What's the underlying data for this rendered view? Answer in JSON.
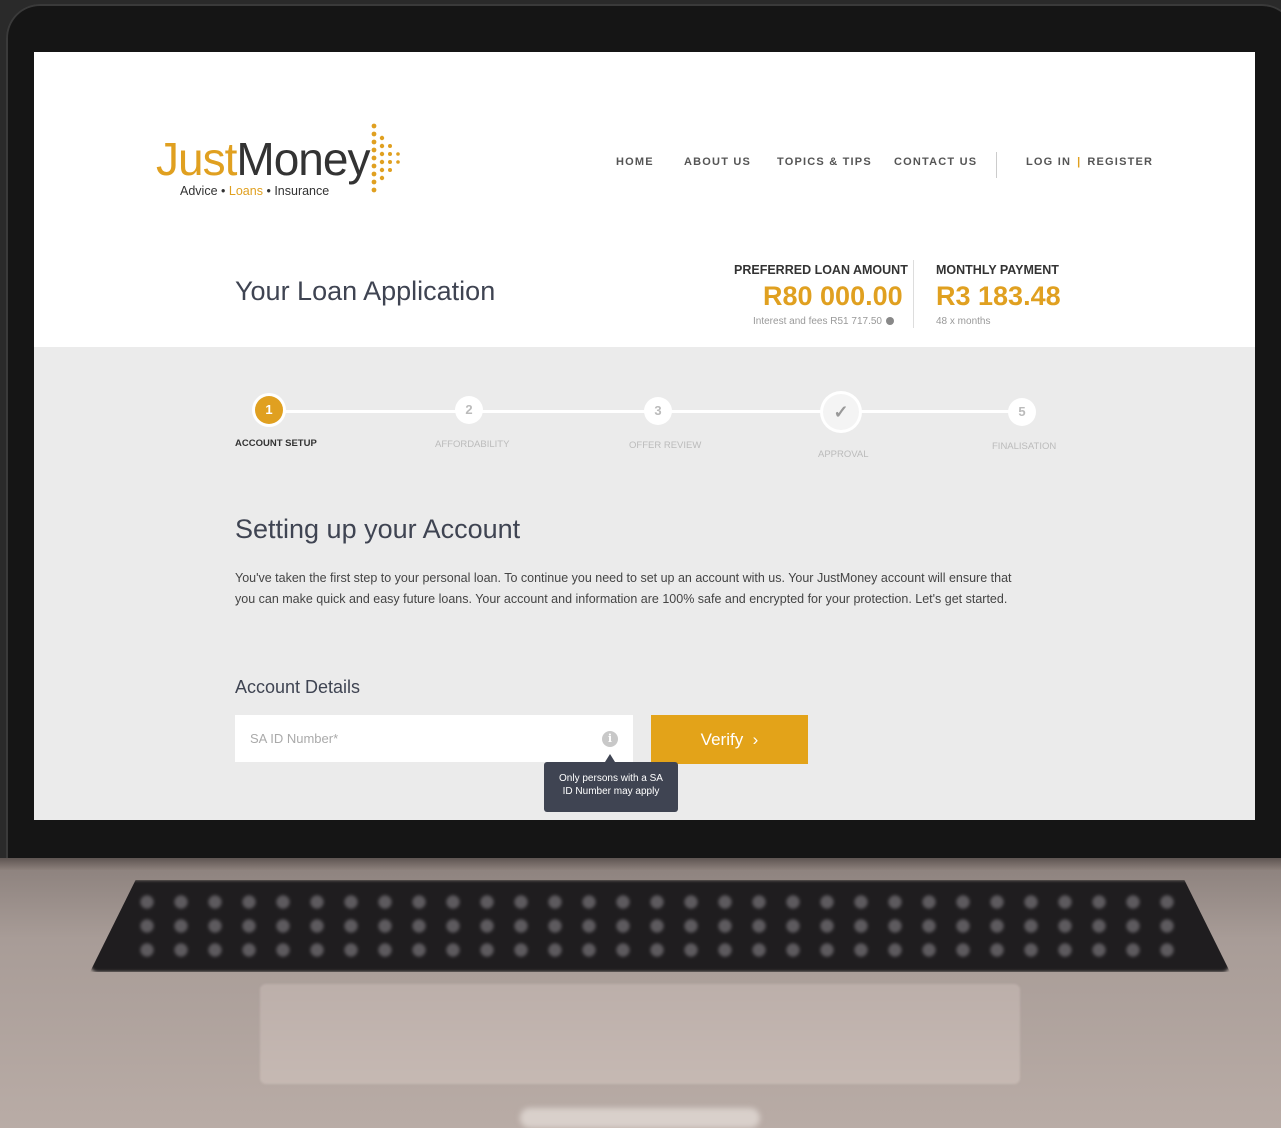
{
  "brand": {
    "name_part1": "Just",
    "name_part2": "Money",
    "tagline_advice": "Advice",
    "tagline_loans": "Loans",
    "tagline_insurance": "Insurance",
    "bullet": "•",
    "accent_color": "#e0a020"
  },
  "nav": {
    "items": [
      {
        "label": "HOME"
      },
      {
        "label": "ABOUT US"
      },
      {
        "label": "TOPICS & TIPS"
      },
      {
        "label": "CONTACT US"
      }
    ],
    "login": "LOG IN",
    "separator": "|",
    "register": "REGISTER"
  },
  "summary": {
    "page_title": "Your Loan Application",
    "loan_label": "PREFERRED LOAN AMOUNT",
    "loan_value": "R80 000.00",
    "loan_sub": "Interest and fees R51 717.50",
    "payment_label": "MONTHLY PAYMENT",
    "payment_value": "R3 183.48",
    "payment_sub": "48 x months"
  },
  "steps": [
    {
      "number": "1",
      "label": "ACCOUNT SETUP",
      "state": "active"
    },
    {
      "number": "2",
      "label": "AFFORDABILITY",
      "state": "pending"
    },
    {
      "number": "3",
      "label": "OFFER REVIEW",
      "state": "pending"
    },
    {
      "number": "✓",
      "label": "APPROVAL",
      "state": "pending"
    },
    {
      "number": "5",
      "label": "FINALISATION",
      "state": "pending"
    }
  ],
  "main": {
    "section_title": "Setting up your Account",
    "intro": "You've taken the first step to your personal loan. To continue you need to set up an account with us. Your JustMoney account will ensure that you can make quick and easy future loans. Your account and information are 100% safe and encrypted for your protection. Let's get started.",
    "details_title": "Account Details",
    "id_placeholder": "SA ID Number*",
    "info_icon": "i",
    "verify_label": "Verify",
    "verify_chevron": "›",
    "tooltip": "Only persons with a SA ID Number may apply"
  }
}
